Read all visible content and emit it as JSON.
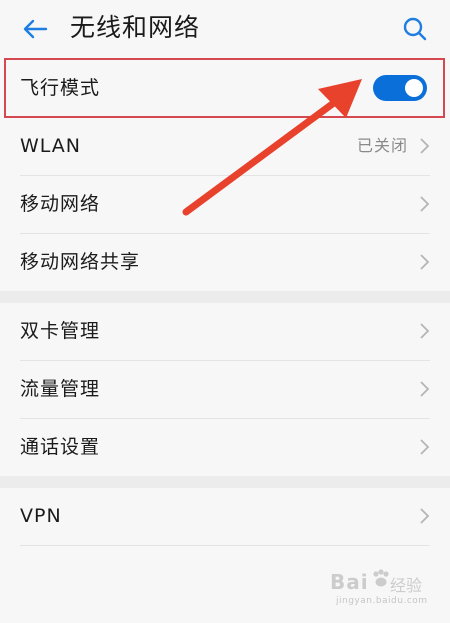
{
  "header": {
    "title": "无线和网络",
    "back_icon": "arrow-left-icon",
    "search_icon": "search-icon"
  },
  "settings": {
    "airplane_mode": {
      "label": "飞行模式",
      "enabled": true
    },
    "wlan": {
      "label": "WLAN",
      "value": "已关闭"
    },
    "mobile_network": {
      "label": "移动网络"
    },
    "tethering": {
      "label": "移动网络共享"
    },
    "dual_sim": {
      "label": "双卡管理"
    },
    "data_usage": {
      "label": "流量管理"
    },
    "call_settings": {
      "label": "通话设置"
    },
    "vpn": {
      "label": "VPN"
    }
  },
  "colors": {
    "accent": "#0a6fd8",
    "highlight_box": "#d6484f",
    "annotation_arrow": "#e8412c",
    "background": "#f7f7f7"
  },
  "watermark": {
    "brand": "Bai",
    "sub": "经验",
    "url": "jingyan.baidu.com"
  }
}
